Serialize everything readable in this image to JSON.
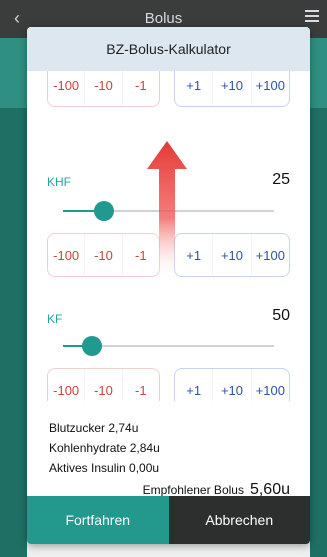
{
  "app": {
    "title": "Bolus"
  },
  "dialog": {
    "title": "BZ-Bolus-Kalkulator",
    "steppers": {
      "minus": [
        "-100",
        "-10",
        "-1"
      ],
      "plus": [
        "+1",
        "+10",
        "+100"
      ]
    },
    "khf": {
      "label": "KHF",
      "value": "25",
      "slider_fraction": 0.16
    },
    "kf": {
      "label": "KF",
      "value": "50",
      "slider_fraction": 0.1
    },
    "summary": {
      "blutzucker": "Blutzucker  2,74u",
      "kohlenhydrate": "Kohlenhydrate  2,84u",
      "aktives_insulin": "Aktives Insulin  0,00u",
      "empfohlen_label": "Empfohlener Bolus",
      "empfohlen_value": "5,60u"
    },
    "buttons": {
      "continue": "Fortfahren",
      "cancel": "Abbrechen"
    }
  },
  "colors": {
    "accent": "#23998e",
    "minus": "#c9453b",
    "plus": "#2e52a8",
    "arrow": "#e53935"
  }
}
